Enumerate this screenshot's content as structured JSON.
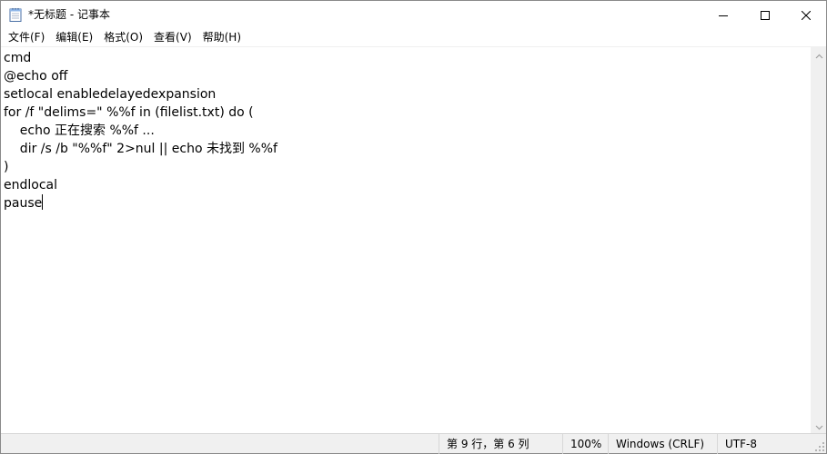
{
  "window": {
    "title": "*无标题 - 记事本",
    "icon": "notepad-icon"
  },
  "controls": {
    "minimize_icon": "minimize-icon",
    "maximize_icon": "maximize-icon",
    "close_icon": "close-icon"
  },
  "menu": {
    "items": [
      {
        "label": "文件(F)"
      },
      {
        "label": "编辑(E)"
      },
      {
        "label": "格式(O)"
      },
      {
        "label": "查看(V)"
      },
      {
        "label": "帮助(H)"
      }
    ]
  },
  "editor": {
    "lines": [
      "cmd",
      "@echo off",
      "setlocal enabledelayedexpansion",
      "for /f \"delims=\" %%f in (filelist.txt) do (",
      "    echo 正在搜索 %%f ...",
      "    dir /s /b \"%%f\" 2>nul || echo 未找到 %%f",
      ")",
      "endlocal",
      "pause"
    ]
  },
  "statusbar": {
    "position": "第 9 行，第 6 列",
    "zoom": "100%",
    "line_ending": "Windows (CRLF)",
    "encoding": "UTF-8"
  }
}
